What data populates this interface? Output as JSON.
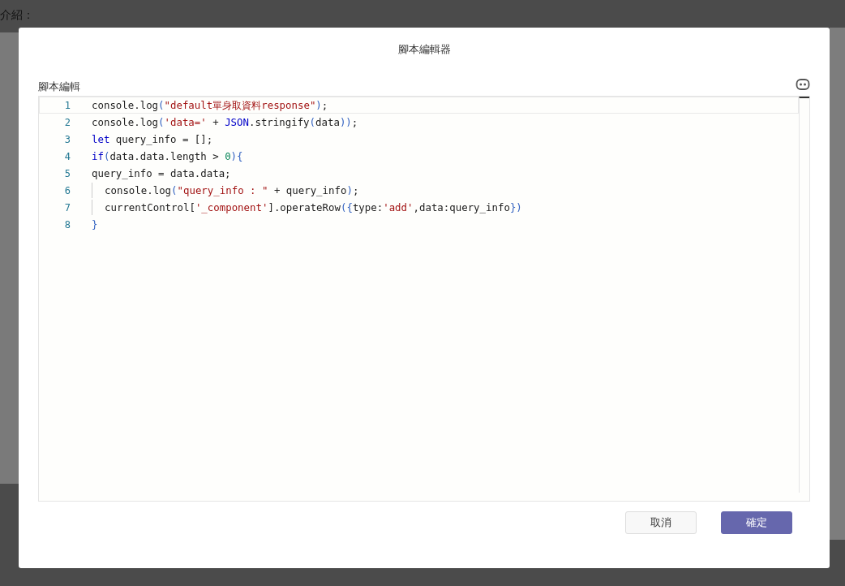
{
  "background": {
    "label": "介紹："
  },
  "dialog": {
    "title": "腳本編輯器",
    "field_label": "腳本編輯",
    "editor": {
      "lines": [
        {
          "number": "1",
          "active": true,
          "indented": false,
          "tokens": [
            {
              "kind": "plain",
              "text": "console.log"
            },
            {
              "kind": "bracket",
              "text": "("
            },
            {
              "kind": "string",
              "text": "\"default單身取資料response\""
            },
            {
              "kind": "bracket",
              "text": ")"
            },
            {
              "kind": "plain",
              "text": ";"
            }
          ]
        },
        {
          "number": "2",
          "active": false,
          "indented": false,
          "tokens": [
            {
              "kind": "plain",
              "text": "console.log"
            },
            {
              "kind": "bracket",
              "text": "("
            },
            {
              "kind": "string",
              "text": "'data='"
            },
            {
              "kind": "plain",
              "text": " + "
            },
            {
              "kind": "keyword",
              "text": "JSON"
            },
            {
              "kind": "plain",
              "text": ".stringify"
            },
            {
              "kind": "bracket",
              "text": "("
            },
            {
              "kind": "plain",
              "text": "data"
            },
            {
              "kind": "bracket",
              "text": "))"
            },
            {
              "kind": "plain",
              "text": ";"
            }
          ]
        },
        {
          "number": "3",
          "active": false,
          "indented": false,
          "tokens": [
            {
              "kind": "keyword",
              "text": "let"
            },
            {
              "kind": "plain",
              "text": " query_info = [];"
            }
          ]
        },
        {
          "number": "4",
          "active": false,
          "indented": false,
          "tokens": [
            {
              "kind": "keyword",
              "text": "if"
            },
            {
              "kind": "bracket",
              "text": "("
            },
            {
              "kind": "plain",
              "text": "data.data.length > "
            },
            {
              "kind": "number",
              "text": "0"
            },
            {
              "kind": "bracket",
              "text": "){"
            }
          ]
        },
        {
          "number": "5",
          "active": false,
          "indented": false,
          "tokens": [
            {
              "kind": "plain",
              "text": "query_info = data.data;"
            }
          ]
        },
        {
          "number": "6",
          "active": false,
          "indented": true,
          "tokens": [
            {
              "kind": "plain",
              "text": "console.log"
            },
            {
              "kind": "bracket",
              "text": "("
            },
            {
              "kind": "string",
              "text": "\"query_info : \""
            },
            {
              "kind": "plain",
              "text": " + query_info"
            },
            {
              "kind": "bracket",
              "text": ")"
            },
            {
              "kind": "plain",
              "text": ";"
            }
          ]
        },
        {
          "number": "7",
          "active": false,
          "indented": true,
          "tokens": [
            {
              "kind": "plain",
              "text": "currentControl["
            },
            {
              "kind": "string",
              "text": "'_component'"
            },
            {
              "kind": "plain",
              "text": "].operateRow"
            },
            {
              "kind": "bracket",
              "text": "({"
            },
            {
              "kind": "plain",
              "text": "type:"
            },
            {
              "kind": "string",
              "text": "'add'"
            },
            {
              "kind": "plain",
              "text": ",data:query_info"
            },
            {
              "kind": "bracket",
              "text": "})"
            }
          ]
        },
        {
          "number": "8",
          "active": false,
          "indented": false,
          "tokens": [
            {
              "kind": "bracket",
              "text": "}"
            }
          ]
        }
      ]
    },
    "buttons": [
      {
        "label": "取消",
        "kind": "secondary"
      },
      {
        "label": "確定",
        "kind": "primary"
      }
    ]
  }
}
